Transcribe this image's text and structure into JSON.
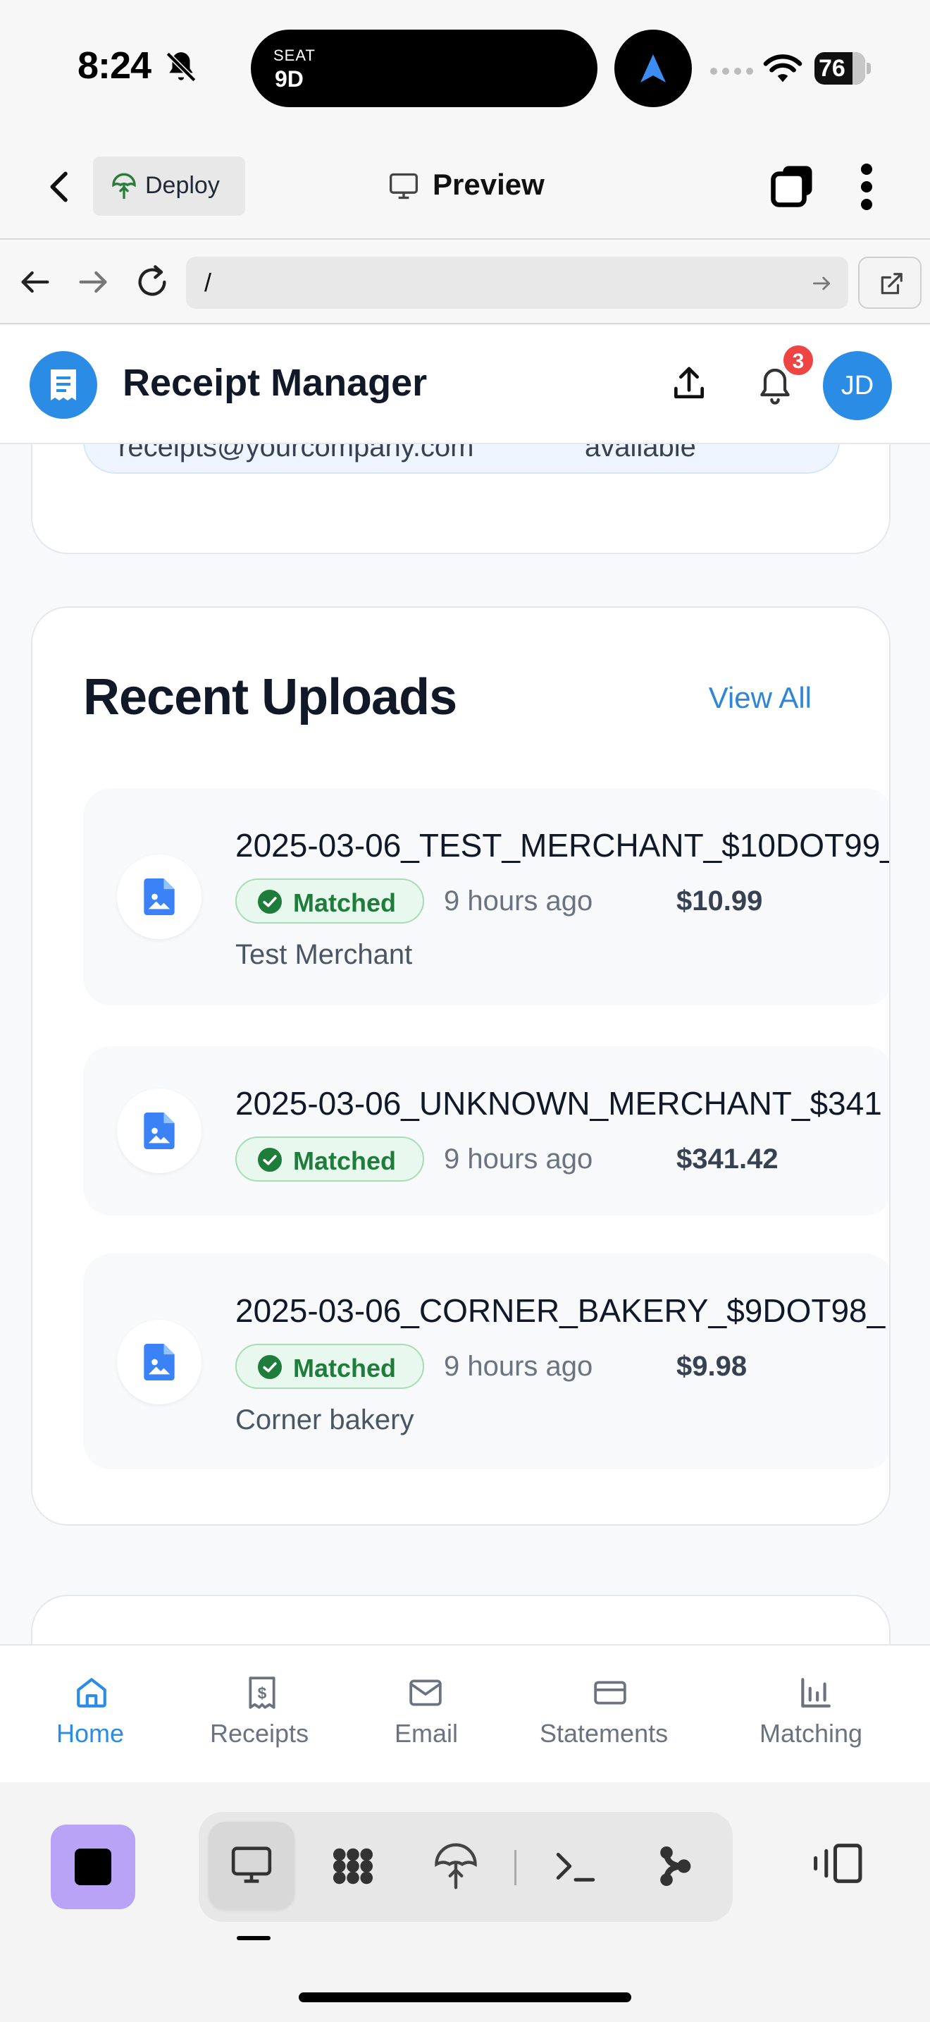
{
  "status_bar": {
    "time": "8:24",
    "island_seat_label": "SEAT",
    "island_seat_value": "9D",
    "battery": "76"
  },
  "app_header": {
    "deploy_label": "Deploy",
    "preview_label": "Preview"
  },
  "browser": {
    "url": "/"
  },
  "rm_header": {
    "title": "Receipt Manager",
    "notification_count": "3",
    "avatar_initials": "JD"
  },
  "info_box": {
    "email": "receipts@yourcompany.com",
    "availability": "available"
  },
  "uploads": {
    "title": "Recent Uploads",
    "view_all": "View All",
    "items": [
      {
        "filename": "2025-03-06_TEST_MERCHANT_$10DOT99_",
        "status": "Matched",
        "time_ago": "9 hours ago",
        "amount": "$10.99",
        "merchant": "Test Merchant"
      },
      {
        "filename": "2025-03-06_UNKNOWN_MERCHANT_$341",
        "status": "Matched",
        "time_ago": "9 hours ago",
        "amount": "$341.42",
        "merchant": ""
      },
      {
        "filename": "2025-03-06_CORNER_BAKERY_$9DOT98_",
        "status": "Matched",
        "time_ago": "9 hours ago",
        "amount": "$9.98",
        "merchant": "Corner bakery"
      }
    ]
  },
  "bottom_nav": {
    "items": [
      {
        "label": "Home",
        "icon": "home-icon",
        "active": true
      },
      {
        "label": "Receipts",
        "icon": "receipt-icon",
        "active": false
      },
      {
        "label": "Email",
        "icon": "mail-icon",
        "active": false
      },
      {
        "label": "Statements",
        "icon": "credit-card-icon",
        "active": false
      },
      {
        "label": "Matching",
        "icon": "bar-chart-icon",
        "active": false
      }
    ]
  },
  "colors": {
    "accent": "#2b8ce6",
    "matched_green": "#1e7d3a",
    "badge_red": "#ef4444",
    "stop_purple": "#b8a3f6"
  }
}
